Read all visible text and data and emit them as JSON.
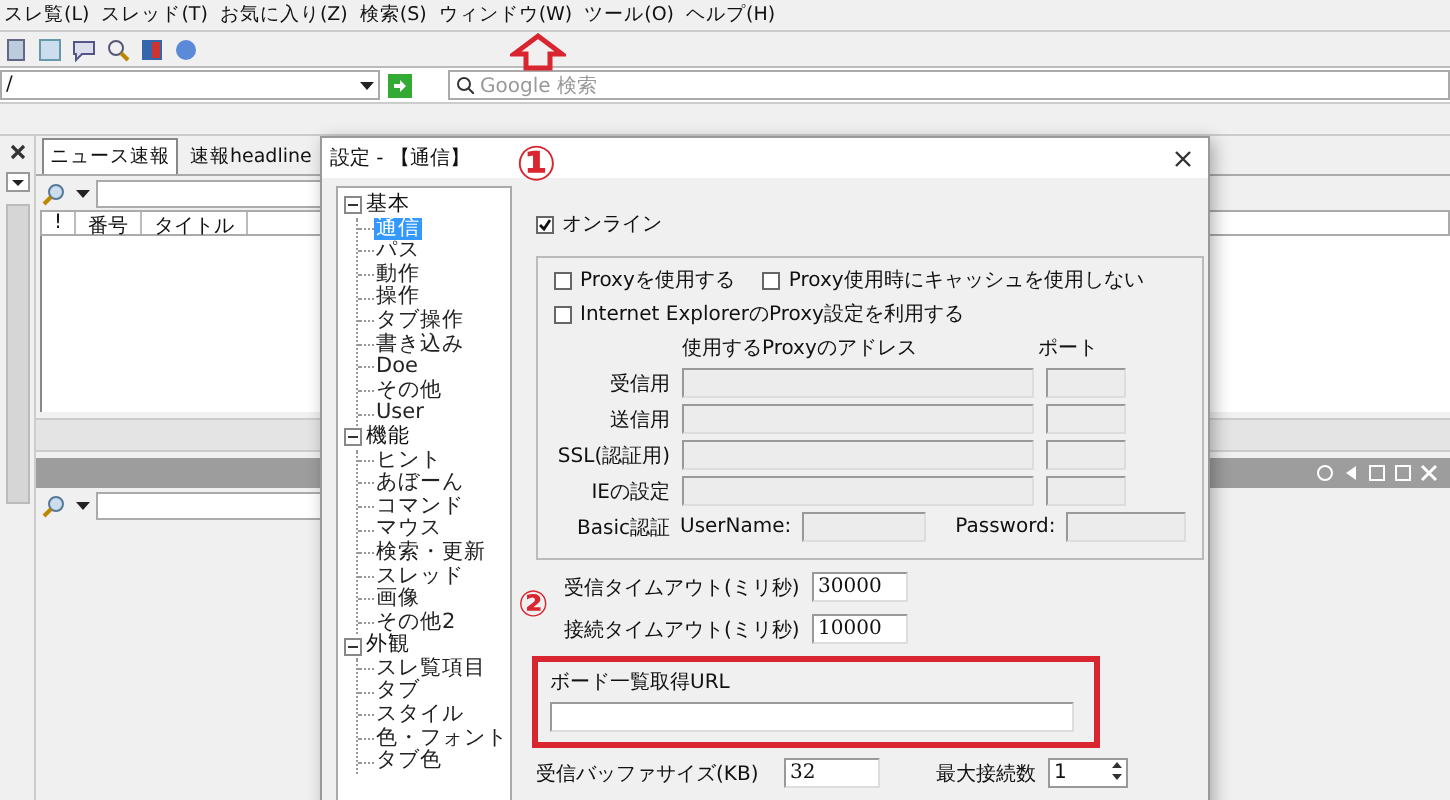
{
  "menu": [
    "スレ覧(L)",
    "スレッド(T)",
    "お気に入り(Z)",
    "検索(S)",
    "ウィンドウ(W)",
    "ツール(O)",
    "ヘルプ(H)"
  ],
  "address": {
    "value": "/"
  },
  "search": {
    "placeholder": "Google 検索"
  },
  "board_tabs": [
    {
      "label": "ニュース速報",
      "selected": true
    },
    {
      "label": "速報headline",
      "selected": false
    }
  ],
  "thread_list": {
    "columns": [
      "!",
      "番号",
      "タイトル"
    ]
  },
  "dialog": {
    "title": "設定 - 【通信】",
    "tree": [
      {
        "label": "基本",
        "expanded": true,
        "children": [
          {
            "label": "通信",
            "selected": true
          },
          {
            "label": "パス",
            "selected": false
          },
          {
            "label": "動作",
            "selected": false
          },
          {
            "label": "操作",
            "selected": false
          },
          {
            "label": "タブ操作",
            "selected": false
          },
          {
            "label": "書き込み",
            "selected": false
          },
          {
            "label": "Doe",
            "selected": false
          },
          {
            "label": "その他",
            "selected": false
          },
          {
            "label": "User",
            "selected": false
          }
        ]
      },
      {
        "label": "機能",
        "expanded": true,
        "children": [
          {
            "label": "ヒント",
            "selected": false
          },
          {
            "label": "あぼーん",
            "selected": false
          },
          {
            "label": "コマンド",
            "selected": false
          },
          {
            "label": "マウス",
            "selected": false
          },
          {
            "label": "検索・更新",
            "selected": false
          },
          {
            "label": "スレッド",
            "selected": false
          },
          {
            "label": "画像",
            "selected": false
          },
          {
            "label": "その他2",
            "selected": false
          }
        ]
      },
      {
        "label": "外観",
        "expanded": true,
        "children": [
          {
            "label": "スレ覧項目",
            "selected": false
          },
          {
            "label": "タブ",
            "selected": false
          },
          {
            "label": "スタイル",
            "selected": false
          },
          {
            "label": "色・フォント",
            "selected": false
          },
          {
            "label": "タブ色",
            "selected": false
          }
        ]
      }
    ],
    "online": {
      "label": "オンライン",
      "checked": true
    },
    "proxy": {
      "checks": [
        {
          "label": "Proxyを使用する",
          "checked": false
        },
        {
          "label": "Proxy使用時にキャッシュを使用しない",
          "checked": false
        }
      ],
      "ie_check": {
        "label": "Internet ExplorerのProxy設定を利用する",
        "checked": false
      },
      "address_header": "使用するProxyのアドレス",
      "port_header": "ポート",
      "disabled": true,
      "rows": [
        "受信用",
        "送信用",
        "SSL(認証用)",
        "IEの設定"
      ],
      "basic_label": "Basic認証",
      "user_label": "UserName:",
      "password_label": "Password:"
    },
    "receive_timeout": {
      "label": "受信タイムアウト(ミリ秒)",
      "value": "30000"
    },
    "connect_timeout": {
      "label": "接続タイムアウト(ミリ秒)",
      "value": "10000"
    },
    "board_url": {
      "label": "ボード一覧取得URL"
    },
    "buffer": {
      "label": "受信バッファサイズ(KB)",
      "value": "32"
    },
    "max_conn": {
      "label": "最大接続数",
      "value": "1"
    }
  },
  "annotations": [
    "①",
    "②"
  ]
}
